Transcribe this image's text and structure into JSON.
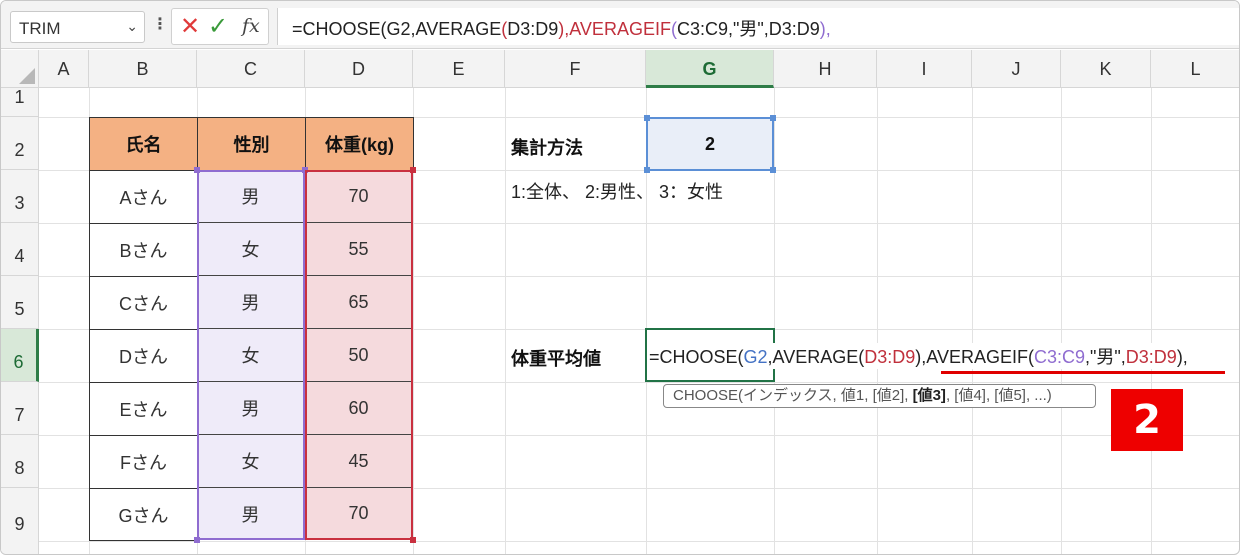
{
  "formula_bar": {
    "name_box": "TRIM",
    "name_box_arrow": "⌄",
    "kebab": "⋮",
    "cancel_glyph": "✕",
    "enter_glyph": "✓",
    "fx_label": "fx",
    "formula": {
      "p1": "=CHOOSE(G2,AVERAGE",
      "p2": "(",
      "p3": "D3:D9",
      "p4": "),AVERAGEIF",
      "p5": "(",
      "p6": "C3:C9,\"男\",D3:D9",
      "p7": "),"
    }
  },
  "columns": [
    "A",
    "B",
    "C",
    "D",
    "E",
    "F",
    "G",
    "H",
    "I",
    "J",
    "K",
    "L"
  ],
  "selected_column": "G",
  "rows": [
    "1",
    "2",
    "3",
    "4",
    "5",
    "6",
    "7",
    "8",
    "9"
  ],
  "selected_row": "6",
  "table": {
    "headers": [
      "氏名",
      "性別",
      "体重(kg)"
    ],
    "rows": [
      [
        "Aさん",
        "男",
        "70"
      ],
      [
        "Bさん",
        "女",
        "55"
      ],
      [
        "Cさん",
        "男",
        "65"
      ],
      [
        "Dさん",
        "女",
        "50"
      ],
      [
        "Eさん",
        "男",
        "60"
      ],
      [
        "Fさん",
        "女",
        "45"
      ],
      [
        "Gさん",
        "男",
        "70"
      ]
    ]
  },
  "aggregate": {
    "label": "集計方法",
    "value": "2",
    "note": "1:全体、 2:男性、 3：女性"
  },
  "result": {
    "label": "体重平均値",
    "edit_formula": {
      "p1": "=CHOOSE(",
      "p2": "G2",
      "p3": ",AVERAGE(",
      "p4": "D3:D9",
      "p5": "),AVERAGEIF(",
      "p6": "C3:C9",
      "p7": ",\"男\",",
      "p8": "D3:D9",
      "p9": "),"
    }
  },
  "tooltip": {
    "pre": "CHOOSE(インデックス, 値1, [値2], ",
    "bold": "[値3]",
    "post": ", [値4], [値5], ...)"
  },
  "badge": "2",
  "colors": {
    "header_fill": "#f4b183",
    "gender_fill": "#efebf9",
    "weight_fill": "#f5dadd",
    "selection_green": "#217346",
    "ref_blue": "#4472c4",
    "ref_red": "#c0303c",
    "ref_purple": "#8f6cd0",
    "badge_red": "#ee0000"
  }
}
